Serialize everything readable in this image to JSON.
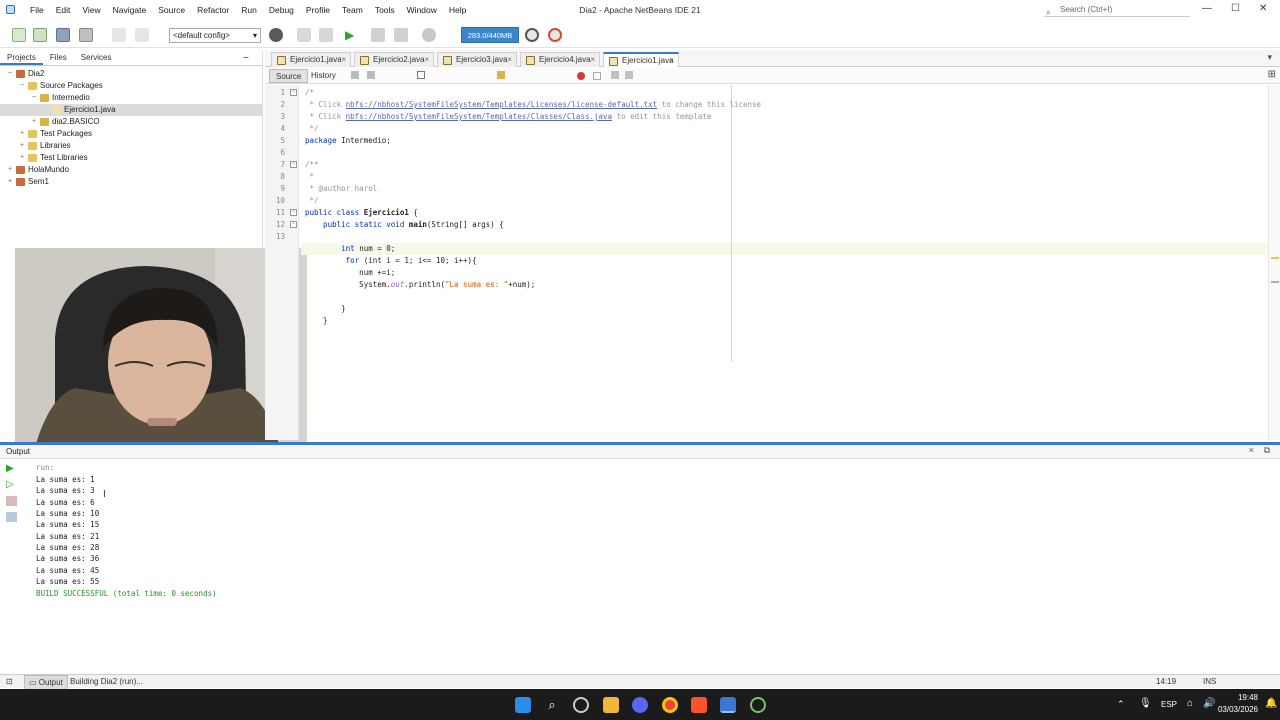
{
  "window": {
    "title": "Dia2 - Apache NetBeans IDE 21",
    "search_placeholder": "Search (Ctrl+I)",
    "minimize": "—",
    "maximize": "☐",
    "close": "✕"
  },
  "menu": [
    "File",
    "Edit",
    "View",
    "Navigate",
    "Source",
    "Refactor",
    "Run",
    "Debug",
    "Profile",
    "Team",
    "Tools",
    "Window",
    "Help"
  ],
  "toolbar": {
    "config_value": "<default config>",
    "memory": "283.0/440MB"
  },
  "projects_panel": {
    "tabs": [
      "Projects",
      "Files",
      "Services"
    ],
    "tree": [
      {
        "label": "Dia2",
        "depth": 0,
        "toggle": "−",
        "icon": "project-icon"
      },
      {
        "label": "Source Packages",
        "depth": 1,
        "toggle": "−",
        "icon": "folder-icon"
      },
      {
        "label": "Intermedio",
        "depth": 2,
        "toggle": "−",
        "icon": "package-icon"
      },
      {
        "label": "Ejercicio1.java",
        "depth": 3,
        "toggle": "",
        "icon": "java-file-icon",
        "selected": true
      },
      {
        "label": "dia2.BASICO",
        "depth": 2,
        "toggle": "+",
        "icon": "package-icon"
      },
      {
        "label": "Test Packages",
        "depth": 1,
        "toggle": "+",
        "icon": "folder-icon"
      },
      {
        "label": "Libraries",
        "depth": 1,
        "toggle": "+",
        "icon": "folder-icon"
      },
      {
        "label": "Test Libraries",
        "depth": 1,
        "toggle": "+",
        "icon": "folder-icon"
      },
      {
        "label": "HolaMundo",
        "depth": 0,
        "toggle": "+",
        "icon": "project-icon"
      },
      {
        "label": "Sem1",
        "depth": 0,
        "toggle": "+",
        "icon": "project-icon"
      }
    ]
  },
  "editor": {
    "tabs": [
      "Ejercicio1.java",
      "Ejercicio2.java",
      "Ejercicio3.java",
      "Ejercicio4.java",
      "Ejercicio1.java"
    ],
    "active_tab": 4,
    "source_label": "Source",
    "history_label": "History",
    "line_numbers": [
      "1",
      "2",
      "3",
      "4",
      "5",
      "6",
      "7",
      "8",
      "9",
      "10",
      "11",
      "12",
      "13"
    ],
    "code": {
      "l1": "/*",
      "l2a": " * Click ",
      "l2b": "nbfs://nbhost/SystemFileSystem/Templates/Licenses/license-default.txt",
      "l2c": " to change this license",
      "l3a": " * Click ",
      "l3b": "nbfs://nbhost/SystemFileSystem/Templates/Classes/Class.java",
      "l3c": " to edit this template",
      "l4": " */",
      "l5a": "package",
      "l5b": " Intermedio;",
      "l7": "/**",
      "l8": " *",
      "l9": " * @author harol",
      "l10": " */",
      "l11a": "public class ",
      "l11b": "Ejercicio1",
      "l11c": " {",
      "l12a": "    public static void ",
      "l12b": "main",
      "l12c": "(String[] args) {",
      "l14a": "        int ",
      "l14b": "num = 0;",
      "l15a": "         for ",
      "l15b": "(int i = 1; i<= 10; i++){",
      "l16": "            num +=i;",
      "l17a": "            System.",
      "l17b": "out",
      "l17c": ".println(",
      "l17d": "\"La suma es: \"",
      "l17e": "+num);",
      "l19": "        }",
      "l20": "    }"
    }
  },
  "output": {
    "tab_label": "Output",
    "run_label": "run:",
    "lines": [
      "La suma es: 1",
      "La suma es: 3",
      "La suma es: 6",
      "La suma es: 10",
      "La suma es: 15",
      "La suma es: 21",
      "La suma es: 28",
      "La suma es: 36",
      "La suma es: 45",
      "La suma es: 55"
    ],
    "build": "BUILD SUCCESSFUL (total time: 0 seconds)"
  },
  "status": {
    "output_tab": "Output",
    "task": "Building Dia2 (run)...",
    "position": "14:19",
    "mode": "INS"
  },
  "taskbar": {
    "lang": "ESP",
    "time": "19:48",
    "date": "03/03/2026"
  },
  "colors": {
    "accent": "#3a78d2",
    "memory_bg": "#3a86c8",
    "taskbar": "#1b1b1b",
    "build_ok": "#2e8b2e"
  }
}
